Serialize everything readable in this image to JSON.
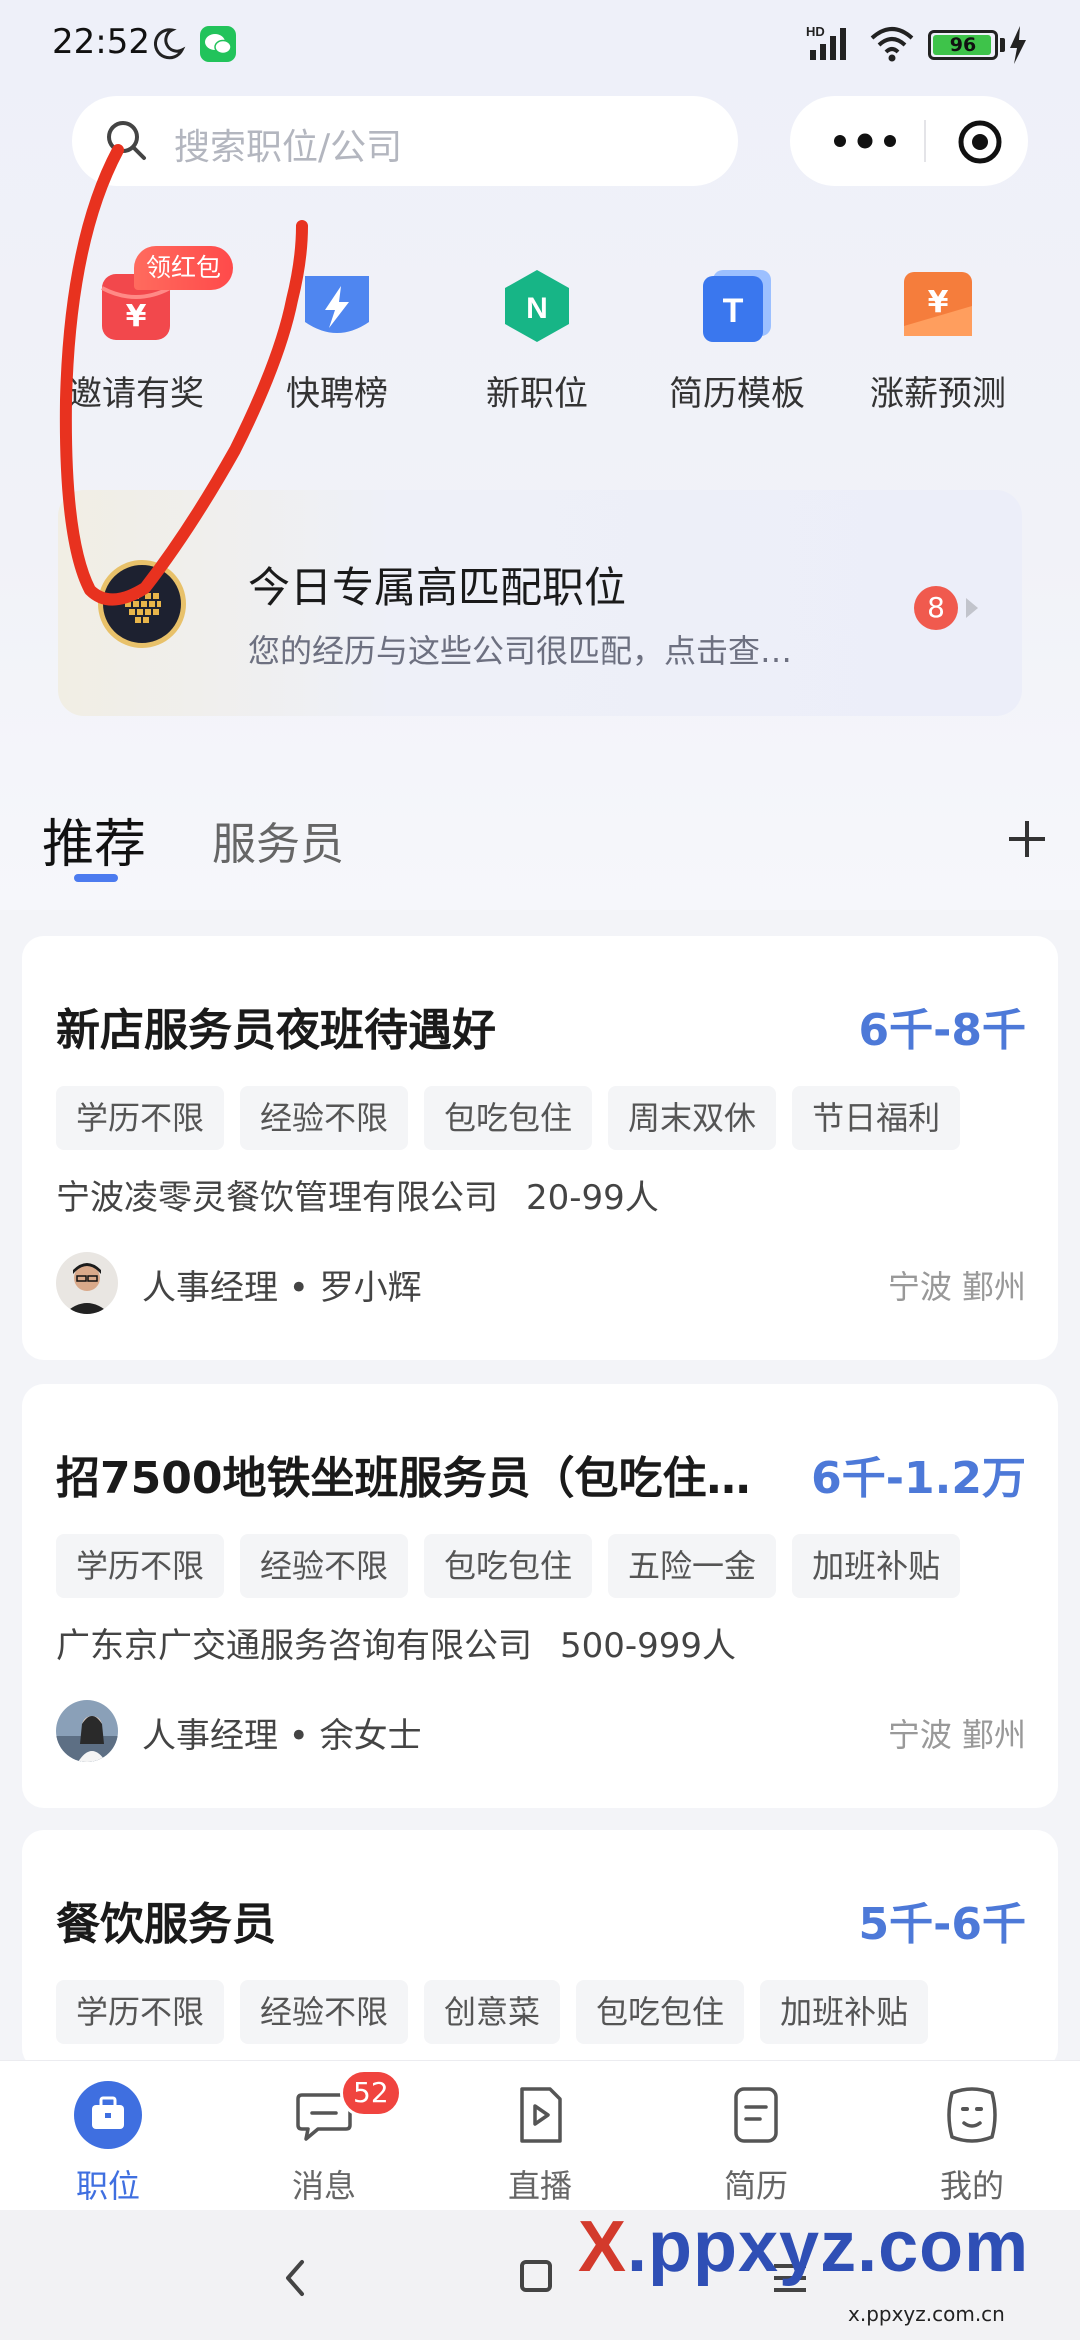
{
  "status_bar": {
    "time": "22:52",
    "battery": "96",
    "battery_level_percent": 96,
    "network": "HD"
  },
  "search": {
    "placeholder": "搜索职位/公司"
  },
  "quick_entries": [
    {
      "label": "邀请有奖",
      "badge": "领红包",
      "icon": "red-envelope-icon",
      "color": "#f2484c"
    },
    {
      "label": "快聘榜",
      "icon": "lightning-bolt-icon",
      "color": "#4f86f0"
    },
    {
      "label": "新职位",
      "icon": "new-n-icon",
      "color": "#17b586"
    },
    {
      "label": "简历模板",
      "icon": "resume-t-icon",
      "color": "#3a77ee"
    },
    {
      "label": "涨薪预测",
      "icon": "salary-yen-icon",
      "color": "#f57d3c"
    }
  ],
  "match_banner": {
    "title": "今日专属高匹配职位",
    "description": "您的经历与这些公司很匹配，点击查…",
    "count": "8"
  },
  "tabs": {
    "recommend": "推荐",
    "waiter": "服务员"
  },
  "jobs": [
    {
      "title": "新店服务员夜班待遇好",
      "salary": "6千-8千",
      "tags": [
        "学历不限",
        "经验不限",
        "包吃包住",
        "周末双休",
        "节日福利"
      ],
      "company": "宁波凌零灵餐饮管理有限公司",
      "size": "20-99人",
      "recruiter": "人事经理 • 罗小辉",
      "location": "宁波 鄞州"
    },
    {
      "title": "招7500地铁坐班服务员（包吃住…",
      "salary": "6千-1.2万",
      "tags": [
        "学历不限",
        "经验不限",
        "包吃包住",
        "五险一金",
        "加班补贴"
      ],
      "company": "广东京广交通服务咨询有限公司",
      "size": "500-999人",
      "recruiter": "人事经理 • 余女士",
      "location": "宁波 鄞州"
    },
    {
      "title": "餐饮服务员",
      "salary": "5千-6千",
      "tags": [
        "学历不限",
        "经验不限",
        "创意菜",
        "包吃包住",
        "加班补贴"
      ]
    }
  ],
  "bottom_nav": [
    {
      "label": "职位",
      "icon": "briefcase-icon"
    },
    {
      "label": "消息",
      "icon": "chat-bubble-icon",
      "badge": "52"
    },
    {
      "label": "直播",
      "icon": "live-play-icon"
    },
    {
      "label": "简历",
      "icon": "resume-doc-icon"
    },
    {
      "label": "我的",
      "icon": "profile-face-icon"
    }
  ],
  "watermark": {
    "x": "X",
    "rest": ".ppxyz.com",
    "url": "x.ppxyz.com.cn"
  },
  "colors": {
    "accent": "#4d79d8",
    "nav_active": "#3f6fe0",
    "badge_red": "#f0443f",
    "annotation_red": "#e8321f"
  }
}
